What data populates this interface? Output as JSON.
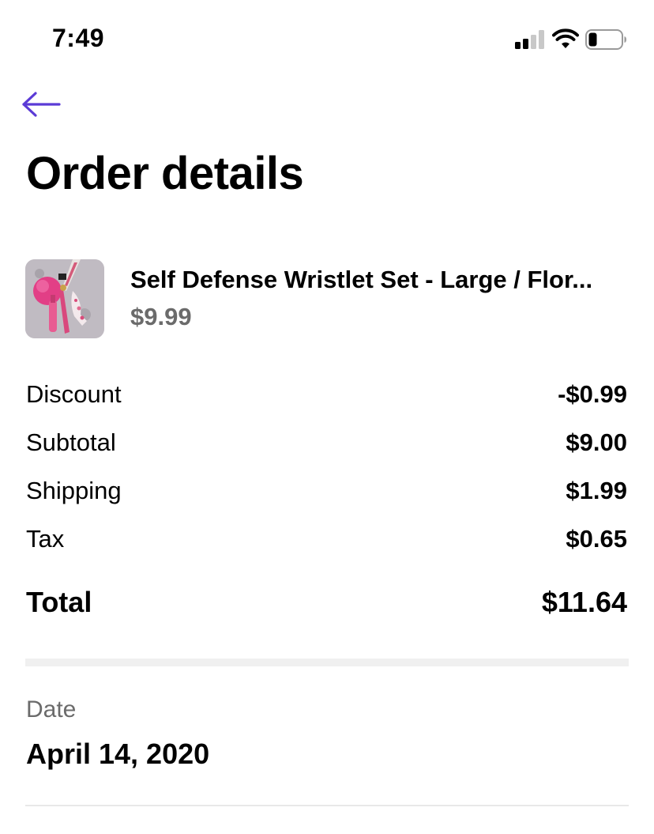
{
  "status_bar": {
    "time": "7:49"
  },
  "colors": {
    "accent": "#5b3bd6",
    "muted_text": "#6b6b6b",
    "divider": "#f0f0f0"
  },
  "header": {
    "back_icon": "arrow-left-icon",
    "title": "Order details"
  },
  "product": {
    "name": "Self Defense Wristlet Set - Large / Flor...",
    "price": "$9.99",
    "image": "product-thumbnail"
  },
  "summary": {
    "discount": {
      "label": "Discount",
      "value": "-$0.99"
    },
    "subtotal": {
      "label": "Subtotal",
      "value": "$9.00"
    },
    "shipping": {
      "label": "Shipping",
      "value": "$1.99"
    },
    "tax": {
      "label": "Tax",
      "value": "$0.65"
    },
    "total": {
      "label": "Total",
      "value": "$11.64"
    }
  },
  "date": {
    "label": "Date",
    "value": "April 14, 2020"
  }
}
